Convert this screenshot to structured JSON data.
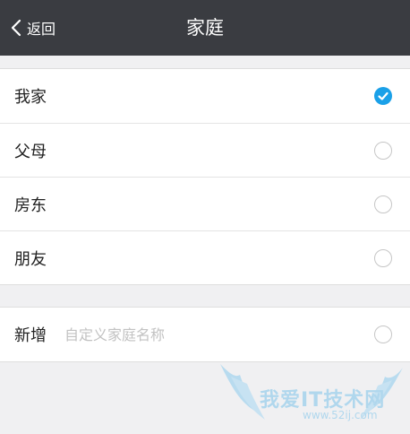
{
  "header": {
    "back_label": "返回",
    "title": "家庭"
  },
  "options": [
    {
      "label": "我家",
      "selected": true
    },
    {
      "label": "父母",
      "selected": false
    },
    {
      "label": "房东",
      "selected": false
    },
    {
      "label": "朋友",
      "selected": false
    }
  ],
  "custom": {
    "label": "新增",
    "placeholder": "自定义家庭名称",
    "selected": false
  },
  "watermark": {
    "text": "我爱IT技术网",
    "url": "www.52ij.com"
  },
  "colors": {
    "nav_bg": "#3a3c41",
    "accent": "#1aa0e8",
    "page_bg": "#f0f0f2"
  }
}
